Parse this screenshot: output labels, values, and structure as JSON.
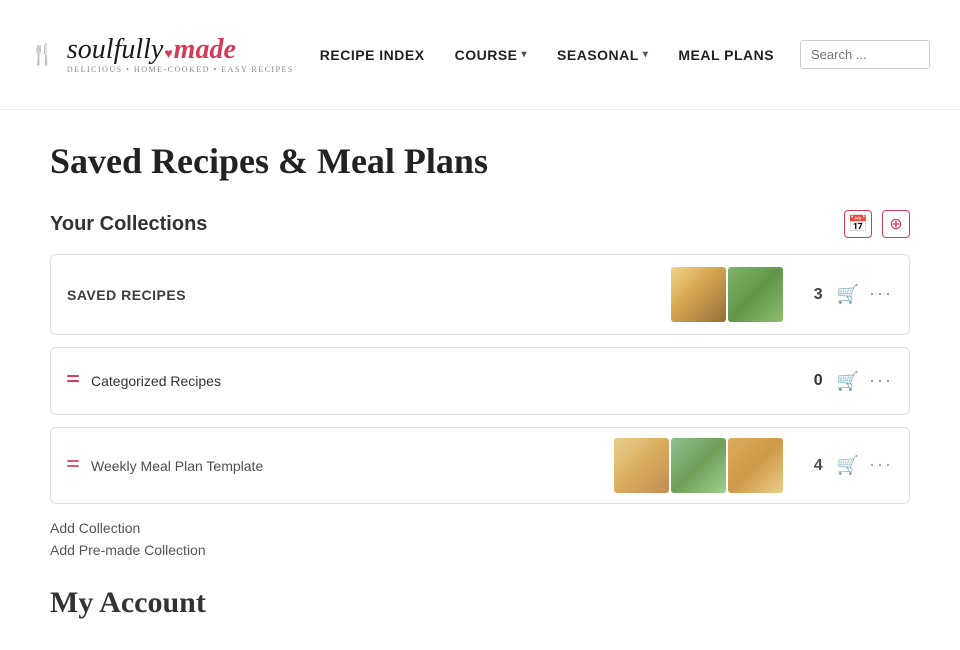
{
  "header": {
    "logo": {
      "soulfully": "soulfully",
      "made": "made",
      "tagline": "DELICIOUS • HOME-COOKED • EASY RECIPES"
    },
    "nav": [
      {
        "label": "RECIPE INDEX",
        "hasDropdown": false
      },
      {
        "label": "COURSE",
        "hasDropdown": true
      },
      {
        "label": "SEASONAL",
        "hasDropdown": true
      },
      {
        "label": "MEAL PLANS",
        "hasDropdown": false
      }
    ],
    "search_placeholder": "Search ..."
  },
  "main": {
    "page_title": "Saved Recipes & Meal Plans",
    "collections_section": {
      "heading": "Your Collections",
      "collections": [
        {
          "id": "saved-recipes",
          "name": "SAVED RECIPES",
          "is_main": true,
          "count": 3,
          "has_images": true
        },
        {
          "id": "categorized-recipes",
          "name": "Categorized Recipes",
          "is_main": false,
          "count": 0,
          "has_images": false
        },
        {
          "id": "weekly-meal-plan",
          "name": "Weekly Meal Plan Template",
          "is_main": false,
          "count": 4,
          "has_images": true
        }
      ],
      "add_collection_label": "Add Collection",
      "add_premade_label": "Add Pre-made Collection"
    },
    "my_account_heading": "My Account"
  }
}
